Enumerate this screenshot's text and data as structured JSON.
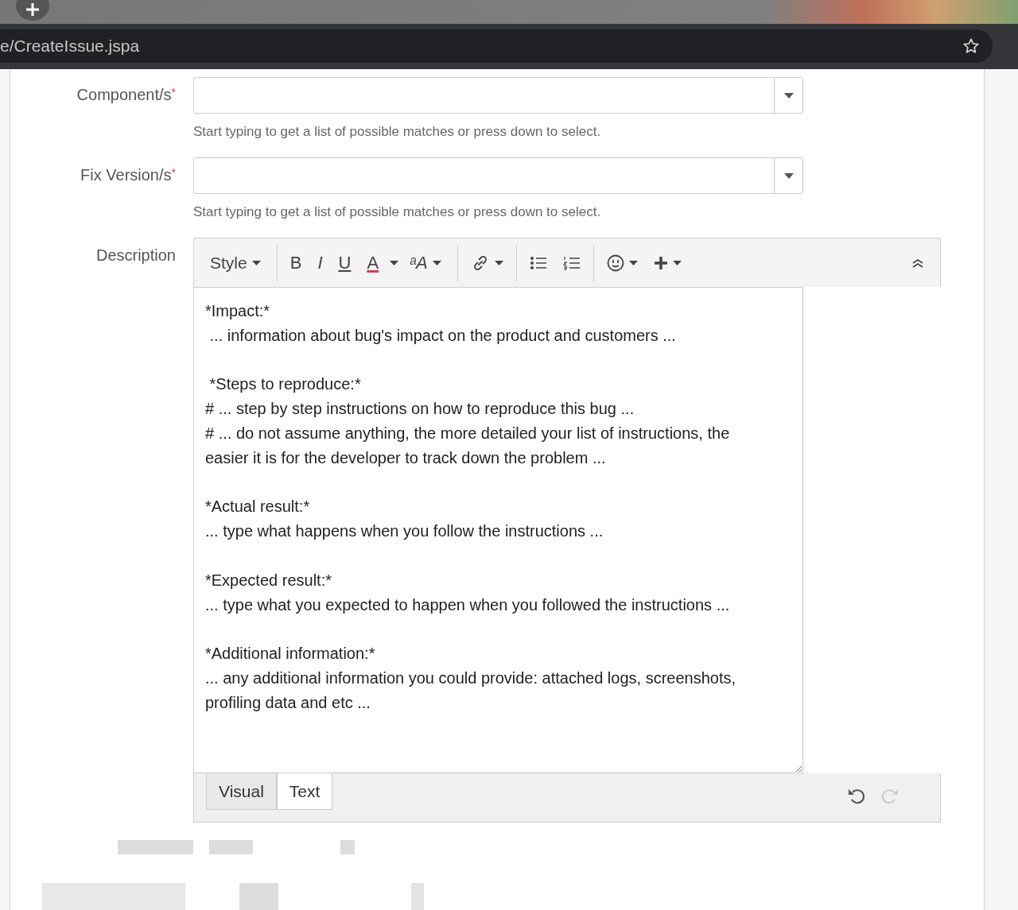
{
  "browser": {
    "url": "e/CreateIssue.jspa"
  },
  "fields": [
    {
      "label": "Component/s",
      "required_mark": "*",
      "hint": "Start typing to get a list of possible matches or press down to select."
    },
    {
      "label": "Fix Version/s",
      "required_mark": "*",
      "hint": "Start typing to get a list of possible matches or press down to select."
    }
  ],
  "description": {
    "label": "Description",
    "toolbar": [
      {
        "kind": "dropdown",
        "label": "Style"
      },
      {
        "kind": "sep"
      },
      {
        "kind": "bold",
        "label": "B"
      },
      {
        "kind": "italic",
        "label": "I"
      },
      {
        "kind": "underline",
        "label": "U"
      },
      {
        "kind": "color",
        "label": "A",
        "color": "#d04437"
      },
      {
        "kind": "caret"
      },
      {
        "kind": "size",
        "label": "ᵃA"
      },
      {
        "kind": "sep"
      },
      {
        "kind": "link"
      },
      {
        "kind": "sep"
      },
      {
        "kind": "bullets"
      },
      {
        "kind": "numbers"
      },
      {
        "kind": "sep"
      },
      {
        "kind": "emoji"
      },
      {
        "kind": "plus"
      },
      {
        "kind": "collapse"
      }
    ],
    "value": "*Impact:*\n ... information about bug's impact on the product and customers ...\n\n *Steps to reproduce:*\n# ... step by step instructions on how to reproduce this bug ...\n# ... do not assume anything, the more detailed your list of instructions, the easier it is for the developer to track down the problem ...\n\n*Actual result:*\n... type what happens when you follow the instructions ...\n\n*Expected result:*\n... type what you expected to happen when you followed the instructions ...\n\n*Additional information:*\n... any additional information you could provide: attached logs, screenshots, profiling data and etc ...",
    "modes": [
      {
        "label": "Visual",
        "selected": false
      },
      {
        "label": "Text",
        "selected": true
      }
    ],
    "undo": {
      "disabled": false
    },
    "redo": {
      "disabled": true
    }
  }
}
